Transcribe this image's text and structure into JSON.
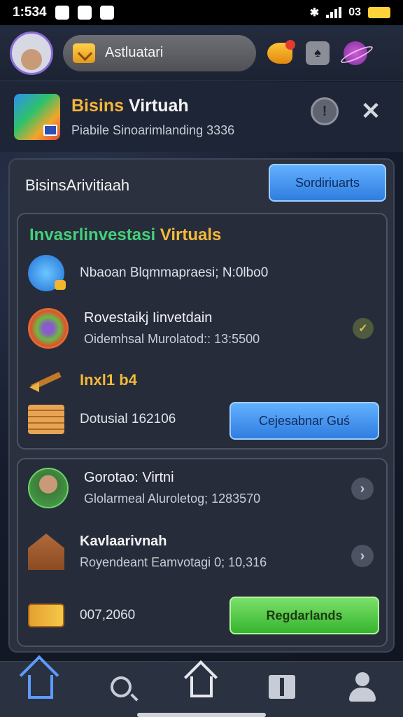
{
  "status_bar": {
    "time": "1:534",
    "right_text": "03"
  },
  "top_bar": {
    "search_label": "Astluatari"
  },
  "app_header": {
    "title_part1": "Bisins",
    "title_part2": "Virtuah",
    "subtitle": "Piabile Sinoarimlanding 3336"
  },
  "panel": {
    "title": "BisinsArivitiaah",
    "button_label": "Sordiriuarts"
  },
  "card1": {
    "heading_green": "Invasrlinvestasi",
    "heading_yellow": "Virtuals",
    "row1_text": "Nbaoan Blqmmapraesi; N:0lbo0",
    "row2_title": "Rovestaikj Iinvetdain",
    "row2_sub": "Oidemhsal Murolatod:: 13:5500",
    "row3_text": "Inxl1 b4",
    "row4_text": "Dotusial 162106",
    "button_label": "Cejesabnar Guś"
  },
  "card2": {
    "row1_title": "Gorotao: Virtni",
    "row1_sub": "Glolarmeal Aluroletog; 1283570",
    "row2_title": "Kavlaarivnah",
    "row2_sub": "Royendeant Eamvotagi 0; 10,316",
    "row3_text": "007,2060",
    "button_label": "Regdarlands"
  },
  "colors": {
    "accent_blue": "#2f7de0",
    "accent_green": "#36b52f",
    "gold": "#f3b93a",
    "green_text": "#44d07a"
  }
}
